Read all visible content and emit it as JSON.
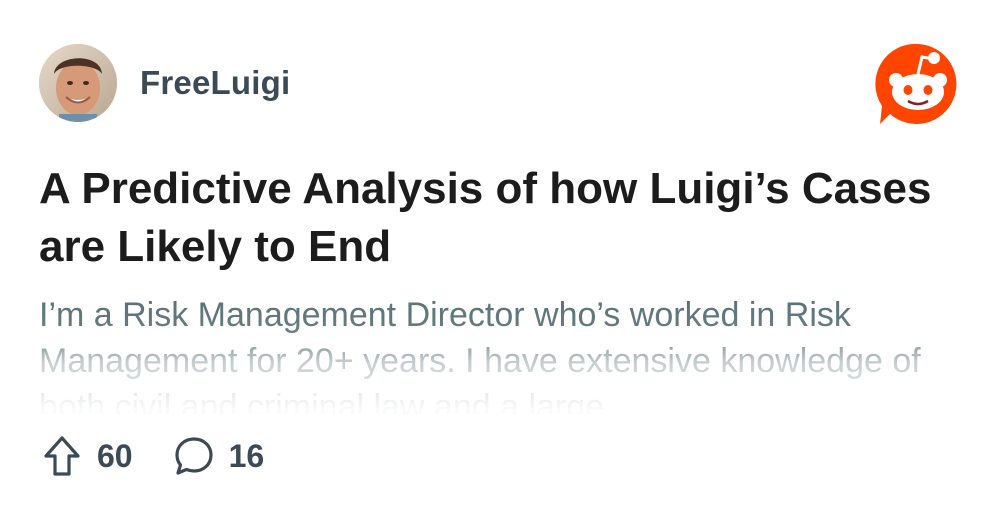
{
  "post": {
    "author": "FreeLuigi",
    "title": "A Predictive Analysis of how Luigi’s Cases are Likely to End",
    "excerpt": "I’m a Risk Management Director who’s worked in Risk Management for 20+ years. I have extensive knowledge of both civil and criminal law and a large",
    "upvotes": "60",
    "comments": "16"
  },
  "icons": {
    "avatar": "user-avatar",
    "logo": "reddit-logo-icon",
    "upvote": "upvote-arrow-icon",
    "comment": "comment-bubble-icon"
  },
  "colors": {
    "brand": "#ff4500",
    "title": "#1c1c1c",
    "muted": "#576f76",
    "meta": "#3b4a54"
  }
}
